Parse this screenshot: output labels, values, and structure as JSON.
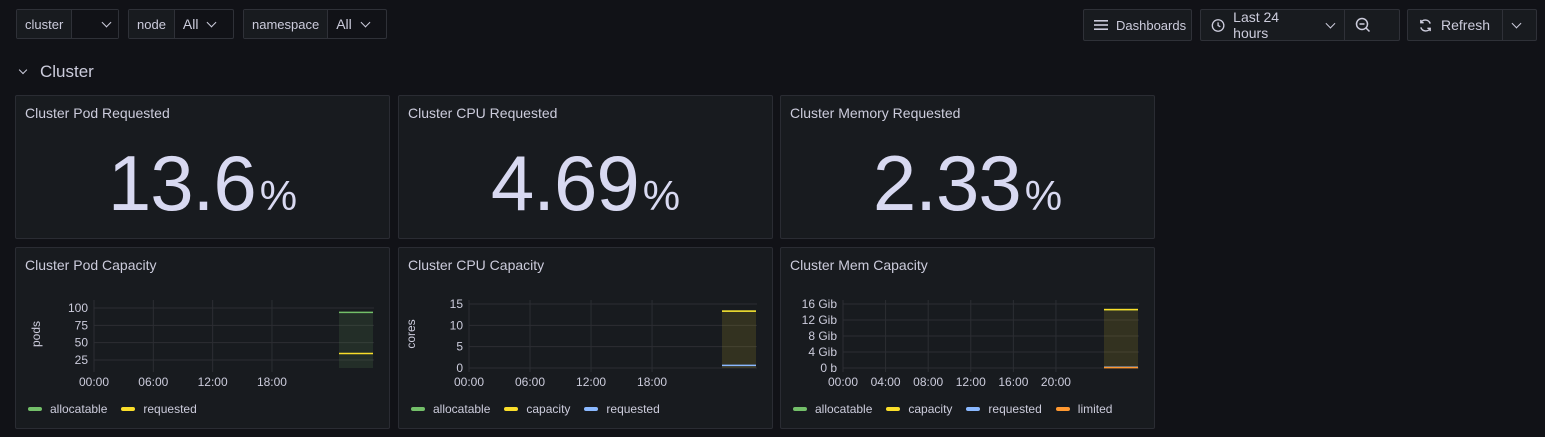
{
  "variables": [
    {
      "label": "cluster",
      "value": ""
    },
    {
      "label": "node",
      "value": "All"
    },
    {
      "label": "namespace",
      "value": "All"
    }
  ],
  "toolbar": {
    "dashboards_label": "Dashboards",
    "time_range": "Last 24 hours",
    "refresh_label": "Refresh"
  },
  "row": {
    "title": "Cluster"
  },
  "stats": [
    {
      "title": "Cluster Pod Requested",
      "value": "13.6",
      "unit": "%"
    },
    {
      "title": "Cluster CPU Requested",
      "value": "4.69",
      "unit": "%"
    },
    {
      "title": "Cluster Memory Requested",
      "value": "2.33",
      "unit": "%"
    }
  ],
  "colors": {
    "allocatable": "#73bf69",
    "capacity": "#fade2a",
    "requested": "#8ab8ff",
    "limited": "#ff9830"
  },
  "chart_data": [
    {
      "type": "line",
      "title": "Cluster Pod Capacity",
      "ylabel": "pods",
      "x_ticks": [
        "00:00",
        "06:00",
        "12:00",
        "18:00"
      ],
      "y_ticks": [
        "100",
        "75",
        "50",
        "25"
      ],
      "ylim": [
        0,
        120
      ],
      "series": [
        {
          "name": "allocatable",
          "color": "#73bf69",
          "value": 110
        },
        {
          "name": "requested",
          "color": "#fade2a",
          "value": 15
        }
      ]
    },
    {
      "type": "line",
      "title": "Cluster CPU Capacity",
      "ylabel": "cores",
      "x_ticks": [
        "00:00",
        "06:00",
        "12:00",
        "18:00"
      ],
      "y_ticks": [
        "15",
        "10",
        "5",
        "0"
      ],
      "ylim": [
        0,
        18
      ],
      "series": [
        {
          "name": "allocatable",
          "color": "#73bf69",
          "value": 16
        },
        {
          "name": "capacity",
          "color": "#fade2a",
          "value": 16
        },
        {
          "name": "requested",
          "color": "#8ab8ff",
          "value": 0.75
        }
      ]
    },
    {
      "type": "line",
      "title": "Cluster Mem Capacity",
      "ylabel": "",
      "x_ticks": [
        "00:00",
        "04:00",
        "08:00",
        "12:00",
        "16:00",
        "20:00"
      ],
      "y_ticks": [
        "16 Gib",
        "12 Gib",
        "8 Gib",
        "4 Gib",
        "0 b"
      ],
      "ylim": [
        0,
        17
      ],
      "series": [
        {
          "name": "allocatable",
          "color": "#73bf69",
          "value": 15.5
        },
        {
          "name": "capacity",
          "color": "#fade2a",
          "value": 15.5
        },
        {
          "name": "requested",
          "color": "#8ab8ff",
          "value": 0.2
        },
        {
          "name": "limited",
          "color": "#ff9830",
          "value": 0.1
        }
      ]
    }
  ]
}
